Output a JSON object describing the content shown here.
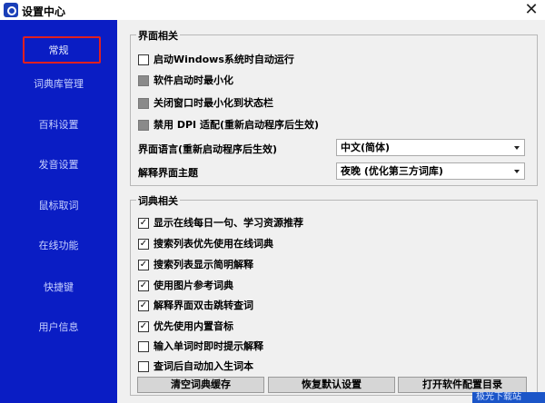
{
  "window": {
    "title": "设置中心",
    "close_glyph": "✕"
  },
  "sidebar": {
    "items": [
      {
        "label": "常规",
        "active": true
      },
      {
        "label": "词典库管理"
      },
      {
        "label": "百科设置"
      },
      {
        "label": "发音设置"
      },
      {
        "label": "鼠标取词"
      },
      {
        "label": "在线功能"
      },
      {
        "label": "快捷键"
      },
      {
        "label": "用户信息"
      }
    ]
  },
  "interface": {
    "title": "界面相关",
    "options": [
      {
        "label": "启动Windows系统时自动运行",
        "checked": false,
        "disabled": false
      },
      {
        "label": "软件启动时最小化",
        "checked": false,
        "disabled": true
      },
      {
        "label": "关闭窗口时最小化到状态栏",
        "checked": false,
        "disabled": true
      },
      {
        "label": "禁用 DPI 适配(重新启动程序后生效)",
        "checked": false,
        "disabled": true
      }
    ],
    "language_label": "界面语言(重新启动程序后生效)",
    "language_value": "中文(简体)",
    "theme_label": "解释界面主题",
    "theme_value": "夜晚 (优化第三方词库)"
  },
  "dictionary": {
    "title": "词典相关",
    "options": [
      {
        "label": "显示在线每日一句、学习资源推荐",
        "checked": true
      },
      {
        "label": "搜索列表优先使用在线词典",
        "checked": true
      },
      {
        "label": "搜索列表显示简明解释",
        "checked": true
      },
      {
        "label": "使用图片参考词典",
        "checked": true
      },
      {
        "label": "解释界面双击跳转查词",
        "checked": true
      },
      {
        "label": "优先使用内置音标",
        "checked": true
      },
      {
        "label": "输入单词时即时提示解释",
        "checked": false
      },
      {
        "label": "查词后自动加入生词本",
        "checked": false
      }
    ]
  },
  "buttons": {
    "clear_cache": "清空词典缓存",
    "restore_defaults": "恢复默认设置",
    "open_config": "打开软件配置目录"
  },
  "check_glyph": "✓",
  "watermark_text": "极光下载站"
}
